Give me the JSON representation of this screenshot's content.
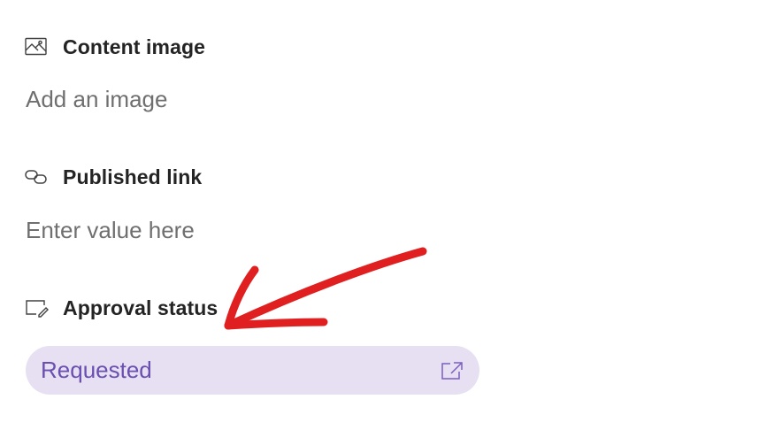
{
  "fields": {
    "content_image": {
      "icon": "image-icon",
      "label": "Content image",
      "placeholder": "Add an image"
    },
    "published_link": {
      "icon": "link-icon",
      "label": "Published link",
      "placeholder": "Enter value here"
    },
    "approval_status": {
      "icon": "edit-status-icon",
      "label": "Approval status",
      "value": "Requested",
      "open_icon": "open-external-icon"
    }
  },
  "colors": {
    "label_text": "#242424",
    "placeholder_text": "#6f6f6f",
    "status_pill_bg": "#e6e0f2",
    "status_pill_text": "#6a4fb0",
    "annotation_arrow": "#e02020"
  },
  "annotation": {
    "icon": "red-arrow-annotation",
    "points_to": "approval_status"
  }
}
